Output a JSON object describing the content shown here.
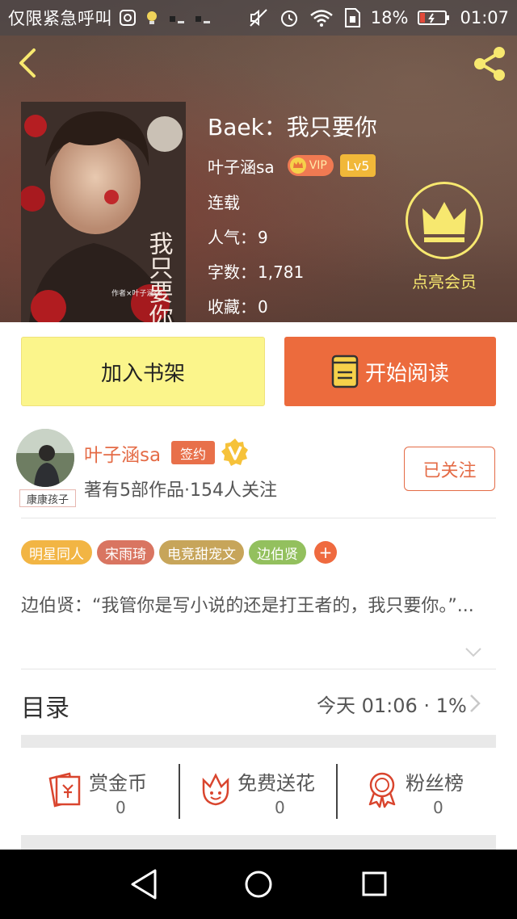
{
  "status_bar": {
    "carrier": "仅限紧急呼叫",
    "battery_percent": "18%",
    "time": "01:07"
  },
  "book": {
    "title": "Baek：我只要你",
    "author": "叶子涵sa",
    "vip_label": "VIP",
    "level": "Lv5",
    "status": "连载",
    "popularity_label": "人气：",
    "popularity": "9",
    "word_count_label": "字数：",
    "word_count": "1,781",
    "favorites_label": "收藏：",
    "favorites": "0",
    "member_label": "点亮会员"
  },
  "actions": {
    "add_shelf": "加入书架",
    "start_reading": "开始阅读"
  },
  "author_card": {
    "avatar_tag": "康康孩子",
    "name": "叶子涵sa",
    "sign_badge": "签约",
    "stats": "著有5部作品·154人关注",
    "follow_label": "已关注"
  },
  "tags": [
    {
      "label": "明星同人",
      "color": "#f2b544"
    },
    {
      "label": "宋雨琦",
      "color": "#d97561"
    },
    {
      "label": "电竞甜宠文",
      "color": "#c7a55a"
    },
    {
      "label": "边伯贤",
      "color": "#93c05e"
    }
  ],
  "tag_more": "+",
  "synopsis": "边伯贤：“我管你是写小说的还是打王者的，我只要你。”...",
  "catalog": {
    "title": "目录",
    "info": "今天 01:06 · 1%"
  },
  "rewards": [
    {
      "label": "赏金币",
      "count": "0"
    },
    {
      "label": "免费送花",
      "count": "0"
    },
    {
      "label": "粉丝榜",
      "count": "0"
    }
  ],
  "colors": {
    "accent_orange": "#ec6b3d",
    "shelf_yellow": "#fbf58b",
    "member_yellow": "#f7e86f",
    "icon_red": "#d9452e"
  }
}
